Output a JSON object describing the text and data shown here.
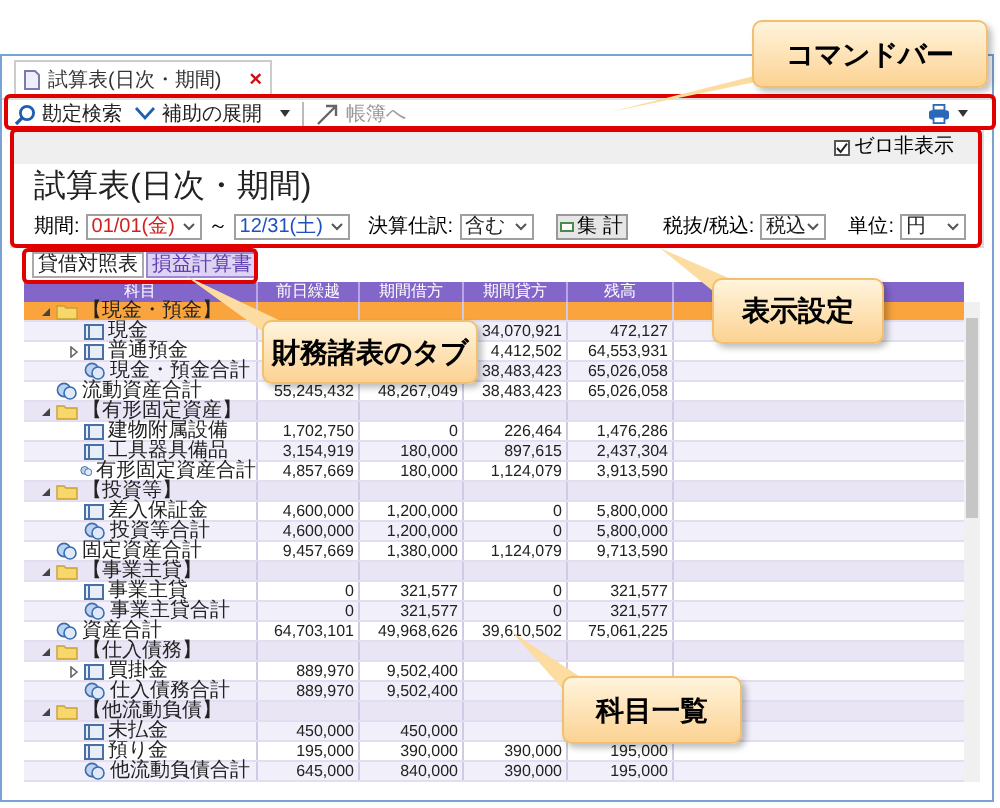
{
  "document_tab": {
    "title": "試算表(日次・期間)",
    "close": "×"
  },
  "command_bar": {
    "items": [
      {
        "kind": "search",
        "label": "勘定検索",
        "disabled": false
      },
      {
        "kind": "expand",
        "label": "補助の展開",
        "disabled": false
      },
      {
        "kind": "jump",
        "label": "帳簿へ",
        "disabled": true
      }
    ]
  },
  "settings": {
    "zero_hide": {
      "label": "ゼロ非表示",
      "checked": true
    },
    "title": "試算表(日次・期間)",
    "period_label": "期間:",
    "from": "01/01(金)",
    "tilde": "～",
    "to": "12/31(土)",
    "closing_label": "決算仕訳:",
    "closing_value": "含む",
    "aggregate_button": "集 計",
    "tax_label": "税抜/税込:",
    "tax_value": "税込",
    "unit_label": "単位:",
    "unit_value": "円"
  },
  "tabs": [
    {
      "label": "貸借対照表",
      "selected": true
    },
    {
      "label": "損益計算書",
      "selected": false
    }
  ],
  "table": {
    "columns": [
      "科目",
      "前日繰越",
      "期間借方",
      "期間貸方",
      "残高"
    ],
    "rows": [
      {
        "kind": "group",
        "name": "【現金・預金】",
        "selected": true,
        "expanded": true,
        "values": {},
        "children": [
          {
            "kind": "account",
            "name": "現金",
            "selected": false,
            "values": {
              "credit": "34,070,921",
              "balance": "472,127"
            }
          },
          {
            "kind": "account",
            "name": "普通預金",
            "selected": false,
            "expanded": false,
            "values": {
              "credit": "4,412,502",
              "balance": "64,553,931"
            }
          },
          {
            "kind": "subtotal",
            "name": "現金・預金合計",
            "selected": false,
            "values": {
              "credit": "38,483,423",
              "balance": "65,026,058"
            }
          }
        ]
      },
      {
        "kind": "subtotal",
        "name": "流動資産合計",
        "selected": false,
        "values": {
          "prev": "55,245,432",
          "debit": "48,267,049",
          "credit": "38,483,423",
          "balance": "65,026,058"
        }
      },
      {
        "kind": "group",
        "name": "【有形固定資産】",
        "selected": false,
        "expanded": true,
        "values": {},
        "children": [
          {
            "kind": "account",
            "name": "建物附属設備",
            "selected": false,
            "values": {
              "prev": "1,702,750",
              "debit": "0",
              "credit": "226,464",
              "balance": "1,476,286"
            }
          },
          {
            "kind": "account",
            "name": "工具器具備品",
            "selected": false,
            "values": {
              "prev": "3,154,919",
              "debit": "180,000",
              "credit": "897,615",
              "balance": "2,437,304"
            }
          },
          {
            "kind": "subtotal",
            "name": "有形固定資産合計",
            "selected": false,
            "values": {
              "prev": "4,857,669",
              "debit": "180,000",
              "credit": "1,124,079",
              "balance": "3,913,590"
            }
          }
        ]
      },
      {
        "kind": "group",
        "name": "【投資等】",
        "selected": false,
        "expanded": true,
        "values": {},
        "children": [
          {
            "kind": "account",
            "name": "差入保証金",
            "selected": false,
            "values": {
              "prev": "4,600,000",
              "debit": "1,200,000",
              "credit": "0",
              "balance": "5,800,000"
            }
          },
          {
            "kind": "subtotal",
            "name": "投資等合計",
            "selected": false,
            "values": {
              "prev": "4,600,000",
              "debit": "1,200,000",
              "credit": "0",
              "balance": "5,800,000"
            }
          }
        ]
      },
      {
        "kind": "subtotal",
        "name": "固定資産合計",
        "selected": false,
        "values": {
          "prev": "9,457,669",
          "debit": "1,380,000",
          "credit": "1,124,079",
          "balance": "9,713,590"
        }
      },
      {
        "kind": "group",
        "name": "【事業主貸】",
        "selected": false,
        "expanded": true,
        "values": {},
        "children": [
          {
            "kind": "account",
            "name": "事業主貸",
            "selected": false,
            "values": {
              "prev": "0",
              "debit": "321,577",
              "credit": "0",
              "balance": "321,577"
            }
          },
          {
            "kind": "subtotal",
            "name": "事業主貸合計",
            "selected": false,
            "values": {
              "prev": "0",
              "debit": "321,577",
              "credit": "0",
              "balance": "321,577"
            }
          }
        ]
      },
      {
        "kind": "subtotal",
        "name": "資産合計",
        "selected": false,
        "values": {
          "prev": "64,703,101",
          "debit": "49,968,626",
          "credit": "39,610,502",
          "balance": "75,061,225"
        }
      },
      {
        "kind": "group",
        "name": "【仕入債務】",
        "selected": false,
        "expanded": true,
        "values": {},
        "children": [
          {
            "kind": "account",
            "name": "買掛金",
            "selected": false,
            "expanded": false,
            "values": {
              "prev": "889,970",
              "debit": "9,502,400"
            }
          },
          {
            "kind": "subtotal",
            "name": "仕入債務合計",
            "selected": false,
            "values": {
              "prev": "889,970",
              "debit": "9,502,400"
            }
          }
        ]
      },
      {
        "kind": "group",
        "name": "【他流動負債】",
        "selected": false,
        "expanded": true,
        "values": {},
        "children": [
          {
            "kind": "account",
            "name": "未払金",
            "selected": false,
            "values": {
              "prev": "450,000",
              "debit": "450,000"
            }
          },
          {
            "kind": "account",
            "name": "預り金",
            "selected": false,
            "values": {
              "prev": "195,000",
              "debit": "390,000",
              "credit": "390,000",
              "balance": "195,000"
            }
          },
          {
            "kind": "subtotal",
            "name": "他流動負債合計",
            "selected": false,
            "values": {
              "prev": "645,000",
              "debit": "840,000",
              "credit": "390,000",
              "balance": "195,000"
            }
          }
        ]
      }
    ]
  },
  "callouts": [
    {
      "text": "コマンドバー"
    },
    {
      "text": "表示設定"
    },
    {
      "text": "財務諸表のタブ"
    },
    {
      "text": "科目一覧"
    }
  ]
}
